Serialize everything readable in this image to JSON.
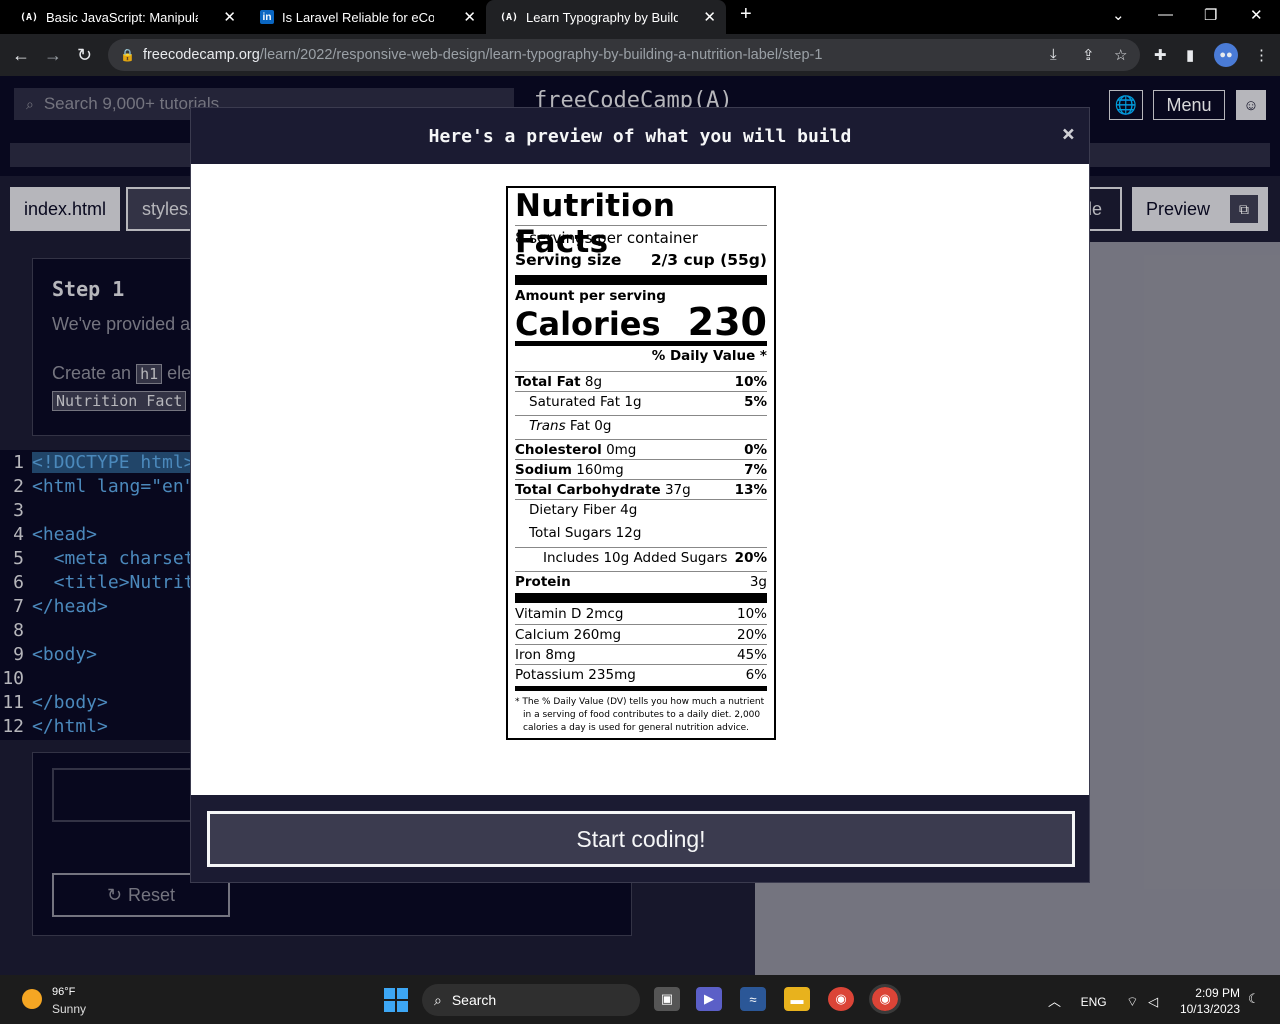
{
  "browser": {
    "tabs": [
      {
        "favicon": "(A)",
        "title": "Basic JavaScript: Manipulate Arrays"
      },
      {
        "favicon": "in",
        "title": "Is Laravel Reliable for eCommerce"
      },
      {
        "favicon": "(A)",
        "title": "Learn Typography by Building a"
      }
    ],
    "url_domain": "freecodecamp.org",
    "url_path": "/learn/2022/responsive-web-design/learn-typography-by-building-a-nutrition-label/step-1"
  },
  "fcc": {
    "search_placeholder": "Search 9,000+ tutorials",
    "brand": "freeCodeCamp(A)",
    "menu_label": "Menu",
    "tabs": {
      "index": "index.html",
      "styles": "styles.css",
      "console_tail": "le",
      "preview": "Preview"
    },
    "step_title": "Step 1",
    "desc_line1": "We've provided a",
    "desc_line2_start": "Create an",
    "desc_chip1": "h1",
    "desc_line2_end": "ele",
    "desc_chip2": "Nutrition Fact",
    "reset_label": "Reset",
    "code_lines": [
      {
        "n": "1",
        "t": "<!DOCTYPE html>"
      },
      {
        "n": "2",
        "t": "<html lang=\"en\">"
      },
      {
        "n": "3",
        "t": ""
      },
      {
        "n": "4",
        "t": "<head>"
      },
      {
        "n": "5",
        "t": "  <meta charset"
      },
      {
        "n": "6",
        "t": "  <title>Nutrit"
      },
      {
        "n": "7",
        "t": "</head>"
      },
      {
        "n": "8",
        "t": ""
      },
      {
        "n": "9",
        "t": "<body>"
      },
      {
        "n": "10",
        "t": ""
      },
      {
        "n": "11",
        "t": "</body>"
      },
      {
        "n": "12",
        "t": "</html>"
      }
    ]
  },
  "modal": {
    "title": "Here's a preview of what you will build",
    "close": "×",
    "start_label": "Start coding!"
  },
  "label": {
    "heading": "Nutrition Facts",
    "servings": "8 servings per container",
    "serving_size_label": "Serving size",
    "serving_size_value": "2/3 cup (55g)",
    "amount_per_serving": "Amount per serving",
    "calories_label": "Calories",
    "calories_value": "230",
    "daily_value_header": "% Daily Value *",
    "rows": [
      {
        "bold": "Total Fat",
        "rest": " 8g",
        "pct": "10%",
        "indent": 0,
        "pct_bold": true
      },
      {
        "bold": "",
        "rest": "Saturated Fat 1g",
        "pct": "5%",
        "indent": 1,
        "pct_bold": true
      },
      {
        "bold": "",
        "italic": "Trans",
        "rest": " Fat 0g",
        "pct": "",
        "indent": 1,
        "pct_bold": true
      },
      {
        "bold": "Cholesterol",
        "rest": " 0mg",
        "pct": "0%",
        "indent": 0,
        "pct_bold": true
      },
      {
        "bold": "Sodium",
        "rest": " 160mg",
        "pct": "7%",
        "indent": 0,
        "pct_bold": true
      },
      {
        "bold": "Total Carbohydrate",
        "rest": " 37g",
        "pct": "13%",
        "indent": 0,
        "pct_bold": true
      },
      {
        "bold": "",
        "rest": "Dietary Fiber 4g",
        "pct": "",
        "indent": 1,
        "pct_bold": true
      },
      {
        "bold": "",
        "rest": "Total Sugars 12g",
        "pct": "",
        "indent": 1,
        "pct_bold": true
      },
      {
        "bold": "",
        "rest": "Includes 10g Added Sugars",
        "pct": "20%",
        "indent": 2,
        "pct_bold": true
      },
      {
        "bold": "Protein",
        "rest": "",
        "pct": "3g",
        "indent": 0,
        "pct_bold": false
      }
    ],
    "vitamins": [
      {
        "name": "Vitamin D 2mcg",
        "pct": "10%"
      },
      {
        "name": "Calcium 260mg",
        "pct": "20%"
      },
      {
        "name": "Iron 8mg",
        "pct": "45%"
      },
      {
        "name": "Potassium 235mg",
        "pct": "6%"
      }
    ],
    "footnote": "* The % Daily Value (DV) tells you how much a nutrient in a serving of food contributes to a daily diet. 2,000 calories a day is used for general nutrition advice."
  },
  "taskbar": {
    "temp": "96°F",
    "condition": "Sunny",
    "search_label": "Search",
    "lang": "ENG",
    "time": "2:09 PM",
    "date": "10/13/2023"
  }
}
